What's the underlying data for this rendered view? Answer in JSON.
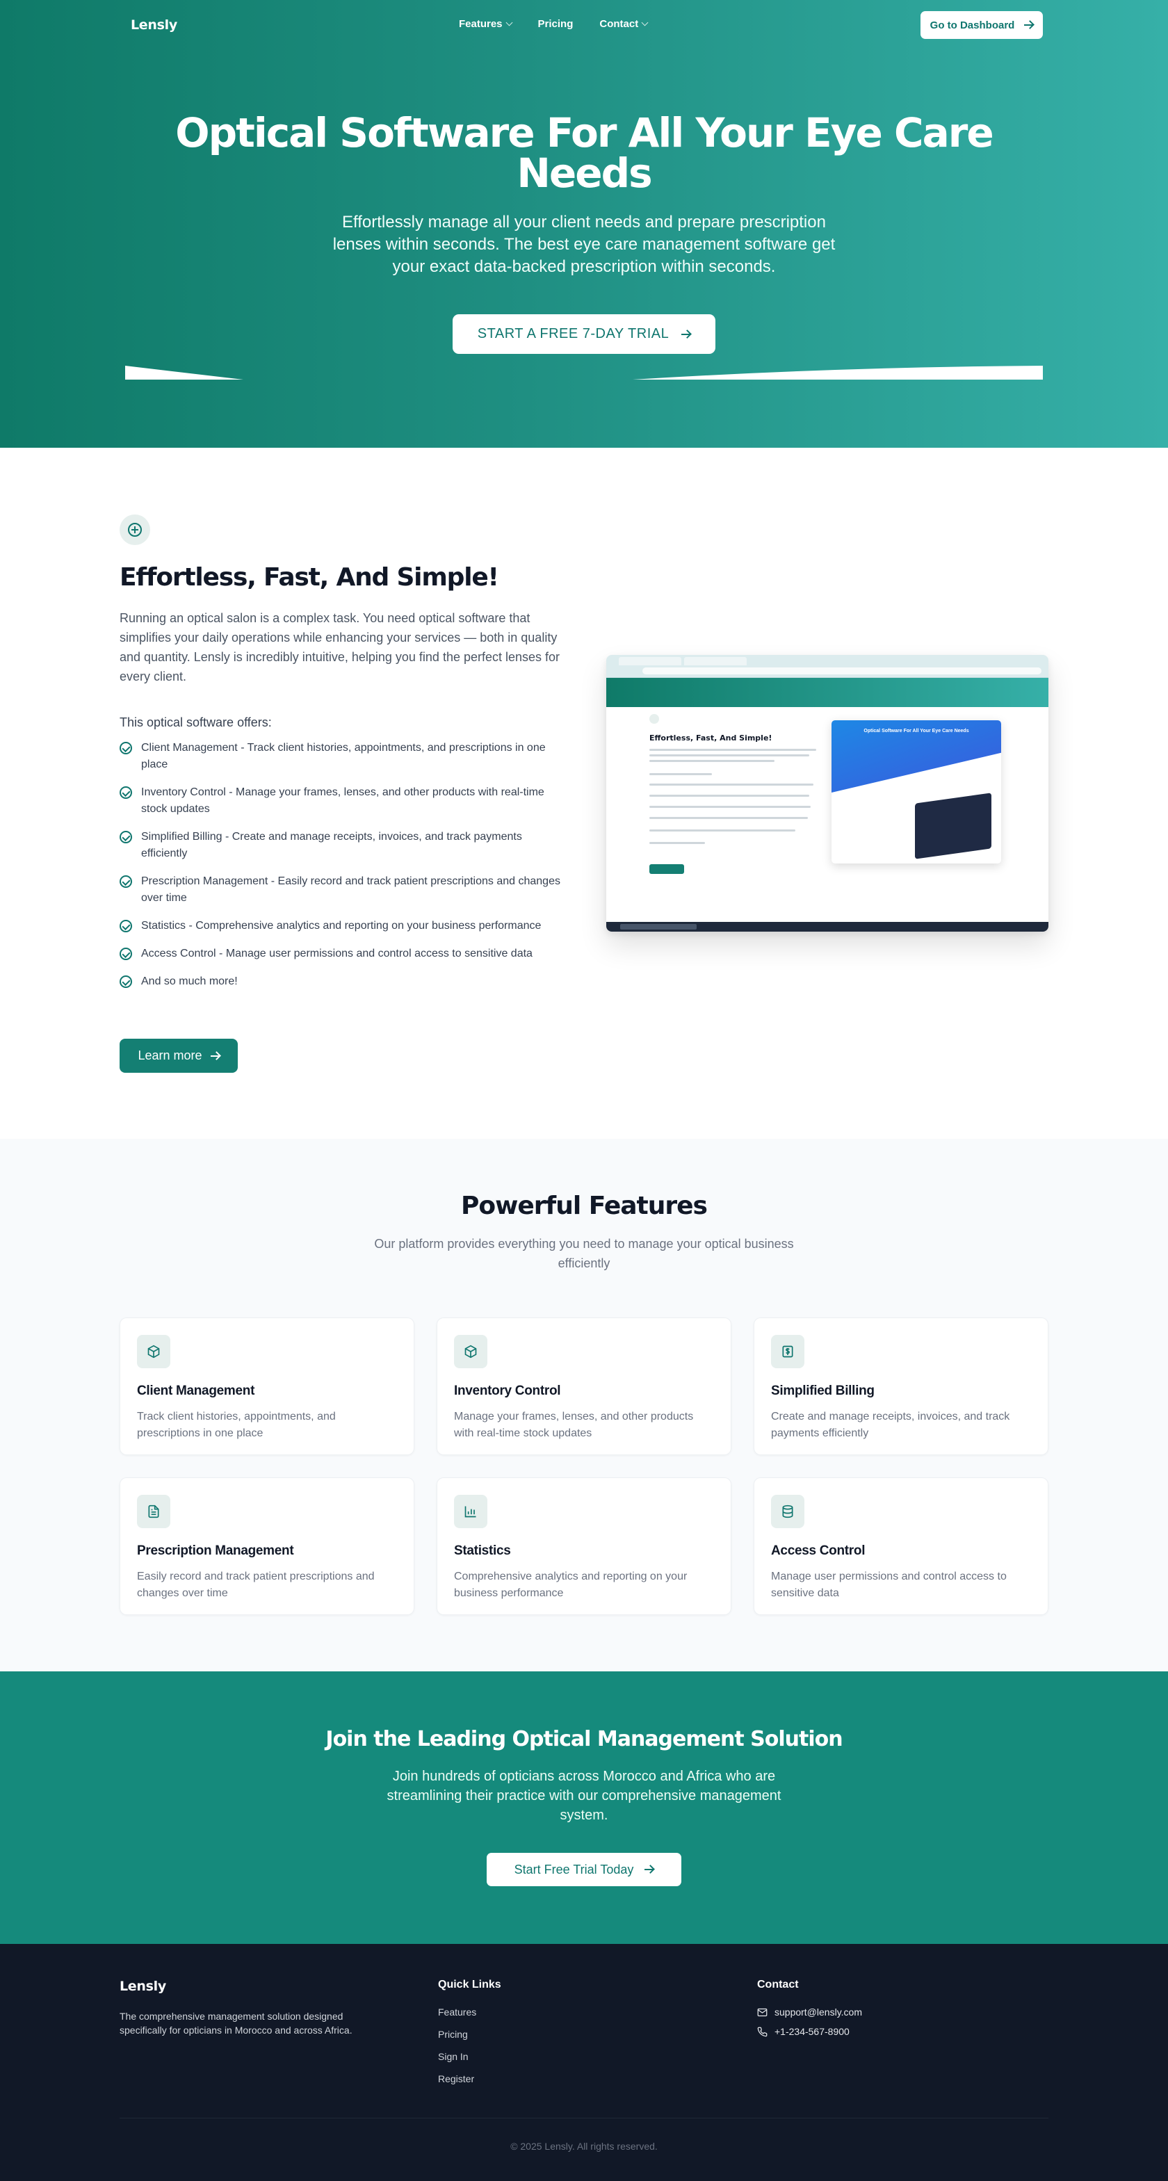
{
  "nav": {
    "logo": "Lensly",
    "links": [
      "Features",
      "Pricing",
      "Contact"
    ],
    "dashboard_label": "Go to Dashboard"
  },
  "hero": {
    "title": "Optical Software For All Your Eye Care Needs",
    "subtitle": "Effortlessly manage all your client needs and prepare prescription lenses within seconds. The best eye care management software get your exact data-backed prescription within seconds.",
    "cta_label": "START A FREE 7-DAY TRIAL"
  },
  "about": {
    "title": "Effortless, Fast, And Simple!",
    "paragraph": "Running an optical salon is a complex task. You need optical software that simplifies your daily operations while enhancing your services — both in quality and quantity. Lensly is incredibly intuitive, helping you find the perfect lenses for every client.",
    "offers_label": "This optical software offers:",
    "offers": [
      "Client Management - Track client histories, appointments, and prescriptions in one place",
      "Inventory Control - Manage your frames, lenses, and other products with real-time stock updates",
      "Simplified Billing - Create and manage receipts, invoices, and track payments efficiently",
      "Prescription Management - Easily record and track patient prescriptions and changes over time",
      "Statistics - Comprehensive analytics and reporting on your business performance",
      "Access Control - Manage user permissions and control access to sensitive data",
      "And so much more!"
    ],
    "learn_more_label": "Learn more",
    "screenshot": {
      "title": "Effortless, Fast, And Simple!",
      "card_title": "Optical Software For All Your Eye Care Needs"
    }
  },
  "features": {
    "title": "Powerful Features",
    "subtitle": "Our platform provides everything you need to manage your optical business efficiently",
    "cards": [
      {
        "icon": "box-icon",
        "title": "Client Management",
        "desc": "Track client histories, appointments, and prescriptions in one place"
      },
      {
        "icon": "box-icon",
        "title": "Inventory Control",
        "desc": "Manage your frames, lenses, and other products with real-time stock updates"
      },
      {
        "icon": "dollar-icon",
        "title": "Simplified Billing",
        "desc": "Create and manage receipts, invoices, and track payments efficiently"
      },
      {
        "icon": "file-text-icon",
        "title": "Prescription Management",
        "desc": "Easily record and track patient prescriptions and changes over time"
      },
      {
        "icon": "bar-chart-icon",
        "title": "Statistics",
        "desc": "Comprehensive analytics and reporting on your business performance"
      },
      {
        "icon": "database-icon",
        "title": "Access Control",
        "desc": "Manage user permissions and control access to sensitive data"
      }
    ]
  },
  "cta": {
    "title": "Join the Leading Optical Management Solution",
    "subtitle": "Join hundreds of opticians across Morocco and Africa who are streamlining their practice with our comprehensive management system.",
    "button_label": "Start Free Trial Today"
  },
  "footer": {
    "logo": "Lensly",
    "description": "The comprehensive management solution designed specifically for opticians in Morocco and across Africa.",
    "quick_links_title": "Quick Links",
    "quick_links": [
      "Features",
      "Pricing",
      "Sign In",
      "Register"
    ],
    "contact_title": "Contact",
    "email": "support@lensly.com",
    "phone": "+1-234-567-8900",
    "copyright": "© 2025 Lensly. All rights reserved."
  },
  "colors": {
    "primary": "#0f766e",
    "hero_start": "#0f7a68",
    "hero_end": "#36b0a8",
    "cta_bg": "#158a7c",
    "footer_bg": "#111827"
  }
}
